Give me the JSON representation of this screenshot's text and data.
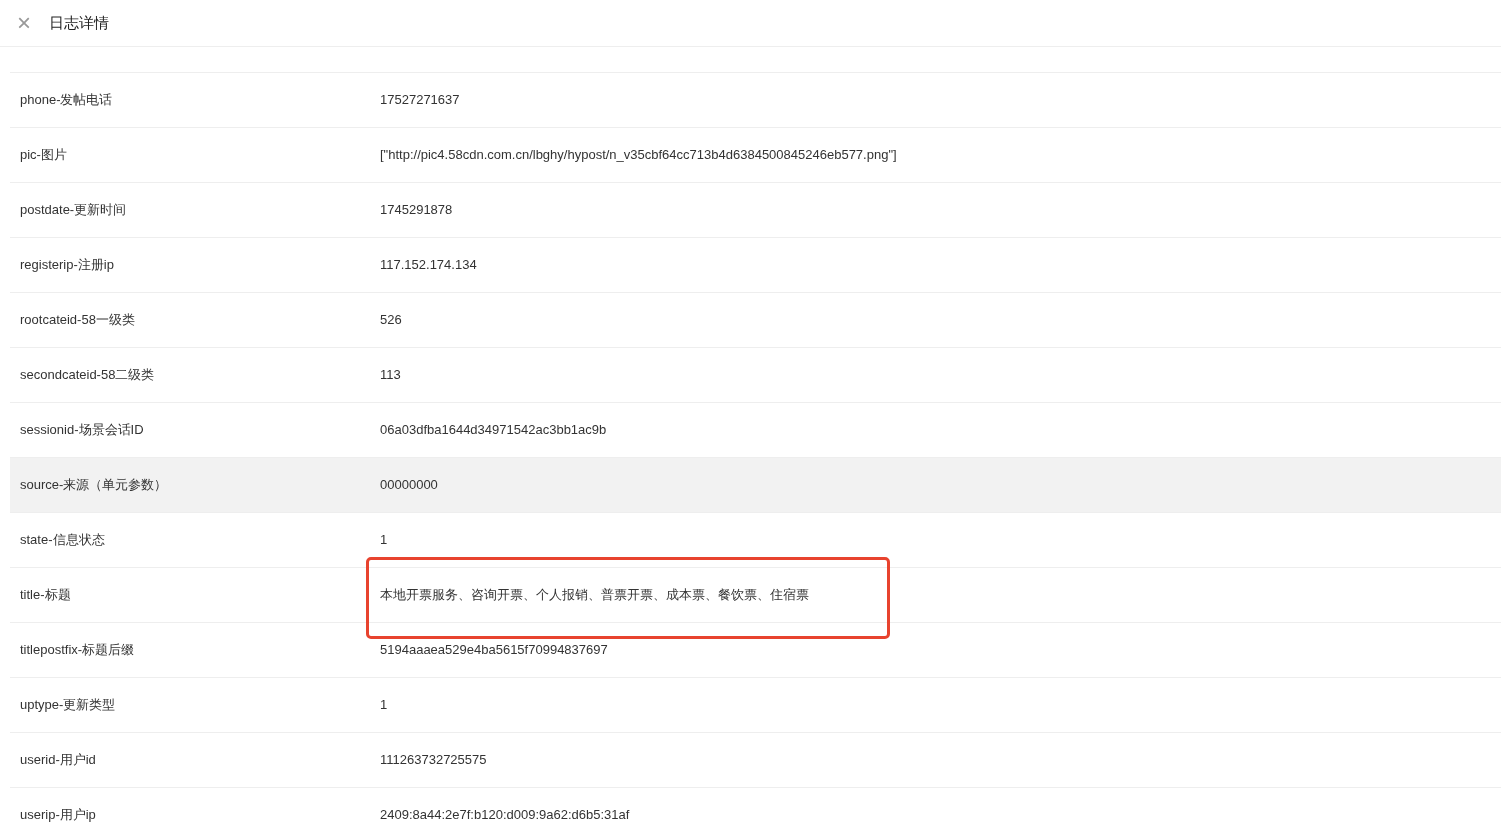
{
  "header": {
    "close_icon": "×",
    "title": "日志详情"
  },
  "rows": [
    {
      "label": "phone-发帖电话",
      "value": "17527271637",
      "highlighted": false
    },
    {
      "label": "pic-图片",
      "value": "[\"http://pic4.58cdn.com.cn/lbghy/hypost/n_v35cbf64cc713b4d6384500845246eb577.png\"]",
      "highlighted": false
    },
    {
      "label": "postdate-更新时间",
      "value": "1745291878",
      "highlighted": false
    },
    {
      "label": "registerip-注册ip",
      "value": "117.152.174.134",
      "highlighted": false
    },
    {
      "label": "rootcateid-58一级类",
      "value": "526",
      "highlighted": false
    },
    {
      "label": "secondcateid-58二级类",
      "value": "113",
      "highlighted": false
    },
    {
      "label": "sessionid-场景会话ID",
      "value": "06a03dfba1644d34971542ac3bb1ac9b",
      "highlighted": false
    },
    {
      "label": "source-来源（单元参数）",
      "value": "00000000",
      "highlighted": true
    },
    {
      "label": "state-信息状态",
      "value": "1",
      "highlighted": false
    },
    {
      "label": "title-标题",
      "value": "本地开票服务、咨询开票、个人报销、普票开票、成本票、餐饮票、住宿票",
      "highlighted": false
    },
    {
      "label": "titlepostfix-标题后缀",
      "value": "5194aaaea529e4ba5615f70994837697",
      "highlighted": false
    },
    {
      "label": "uptype-更新类型",
      "value": "1",
      "highlighted": false
    },
    {
      "label": "userid-用户id",
      "value": "111263732725575",
      "highlighted": false
    },
    {
      "label": "userip-用户ip",
      "value": "2409:8a44:2e7f:b120:d009:9a62:d6b5:31af",
      "highlighted": false
    }
  ]
}
